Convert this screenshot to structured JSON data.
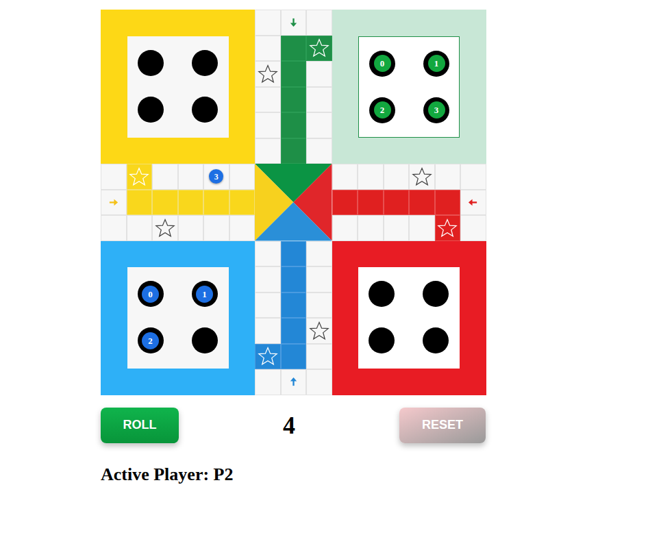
{
  "homes": [
    {
      "kind": "yellow",
      "slots": [
        {
          "occupied": false
        },
        {
          "occupied": false
        },
        {
          "occupied": false
        },
        {
          "occupied": false
        }
      ]
    },
    {
      "kind": "green",
      "slots": [
        {
          "occupied": true,
          "label": "0",
          "color": "#12a83f"
        },
        {
          "occupied": true,
          "label": "1",
          "color": "#12a83f"
        },
        {
          "occupied": true,
          "label": "2",
          "color": "#12a83f"
        },
        {
          "occupied": true,
          "label": "3",
          "color": "#12a83f"
        }
      ]
    },
    {
      "kind": "blue",
      "slots": [
        {
          "occupied": true,
          "label": "0",
          "color": "#1d6fe3"
        },
        {
          "occupied": true,
          "label": "1",
          "color": "#1d6fe3"
        },
        {
          "occupied": true,
          "label": "2",
          "color": "#1d6fe3"
        },
        {
          "occupied": false
        }
      ]
    },
    {
      "kind": "red",
      "slots": [
        {
          "occupied": false
        },
        {
          "occupied": false
        },
        {
          "occupied": false
        },
        {
          "occupied": false
        }
      ]
    }
  ],
  "board_tokens": [
    {
      "label": "3",
      "color": "#1d6fe3",
      "row": 6,
      "col": 4
    }
  ],
  "buttons": {
    "roll": "ROLL",
    "reset": "RESET"
  },
  "dice": "4",
  "active_player": "Active Player: P2"
}
